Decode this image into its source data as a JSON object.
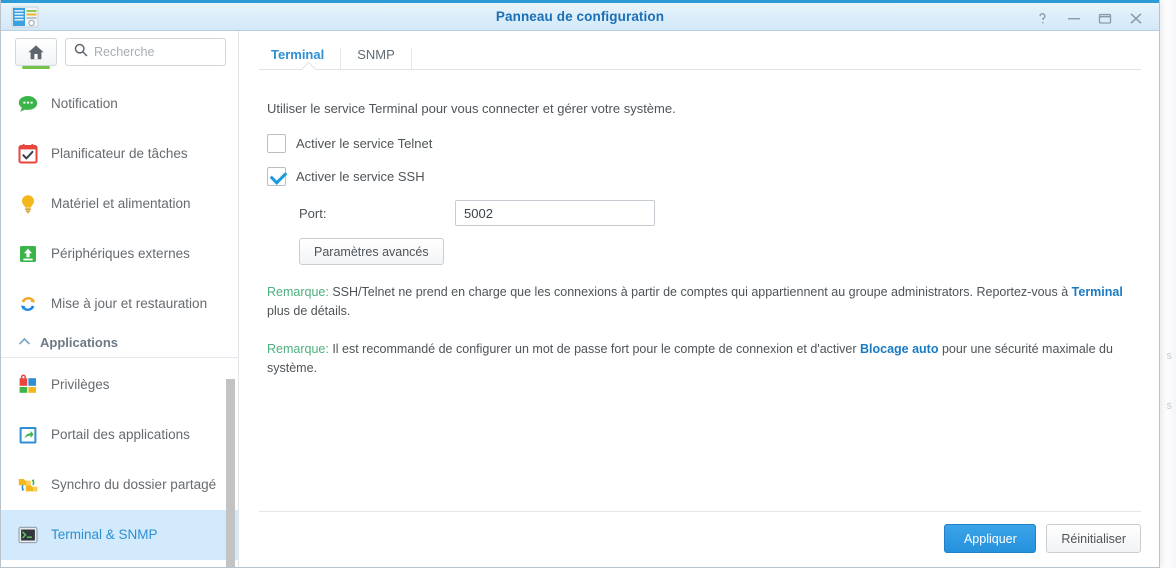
{
  "window": {
    "title": "Panneau de configuration",
    "app_icon": "control-panel-icon",
    "controls": [
      {
        "name": "help-button",
        "glyph": "?"
      },
      {
        "name": "minimize-button",
        "glyph": "—"
      },
      {
        "name": "maximize-button",
        "glyph": "□"
      },
      {
        "name": "close-button",
        "glyph": "✕"
      }
    ]
  },
  "sidebar": {
    "home_button": "home-icon",
    "search": {
      "placeholder": "Recherche",
      "value": "",
      "icon": "search-icon"
    },
    "items": [
      {
        "label": "Notification",
        "icon": "chat-bubble-icon",
        "selected": false
      },
      {
        "label": "Planificateur de tâches",
        "icon": "calendar-check-icon",
        "selected": false
      },
      {
        "label": "Matériel et alimentation",
        "icon": "lightbulb-icon",
        "selected": false
      },
      {
        "label": "Périphériques externes",
        "icon": "external-device-icon",
        "selected": false
      },
      {
        "label": "Mise à jour et restauration",
        "icon": "refresh-icon",
        "selected": false
      }
    ],
    "section": {
      "label": "Applications",
      "chevron": "chevron-up-icon",
      "items": [
        {
          "label": "Privilèges",
          "icon": "privileges-icon",
          "selected": false
        },
        {
          "label": "Portail des applications",
          "icon": "app-portal-icon",
          "selected": false
        },
        {
          "label": "Synchro du dossier partagé",
          "icon": "folder-sync-icon",
          "selected": false
        },
        {
          "label": "Terminal & SNMP",
          "icon": "terminal-icon",
          "selected": true
        }
      ]
    }
  },
  "main": {
    "tabs": [
      {
        "label": "Terminal",
        "active": true
      },
      {
        "label": "SNMP",
        "active": false
      }
    ],
    "intro": "Utiliser le service Terminal pour vous connecter et gérer votre système.",
    "telnet": {
      "label": "Activer le service Telnet",
      "checked": false
    },
    "ssh": {
      "label": "Activer le service SSH",
      "checked": true
    },
    "port": {
      "label": "Port:",
      "value": "5002"
    },
    "advanced_button": "Paramètres avancés",
    "remarks": [
      {
        "keyword": "Remarque:",
        "text_before": " SSH/Telnet ne prend en charge que les connexions à partir de comptes qui appartiennent au groupe administrators. Reportez-vous à ",
        "link": "Terminal",
        "text_after": " plus de détails."
      },
      {
        "keyword": "Remarque:",
        "text_before": " Il est recommandé de configurer un mot de passe fort pour le compte de connexion et d'activer ",
        "link": "Blocage auto",
        "text_after": " pour une sécurité maximale du système."
      }
    ]
  },
  "footer": {
    "apply_label": "Appliquer",
    "reset_label": "Réinitialiser"
  },
  "colors": {
    "accent_blue": "#2e8fd4",
    "title_blue": "#1a6fb5",
    "selected_row": "#d2eafc",
    "remark_green": "#4caf7d",
    "link_blue": "#1a7bc4",
    "home_green": "#73c245",
    "primary_button": "#2691dd"
  }
}
